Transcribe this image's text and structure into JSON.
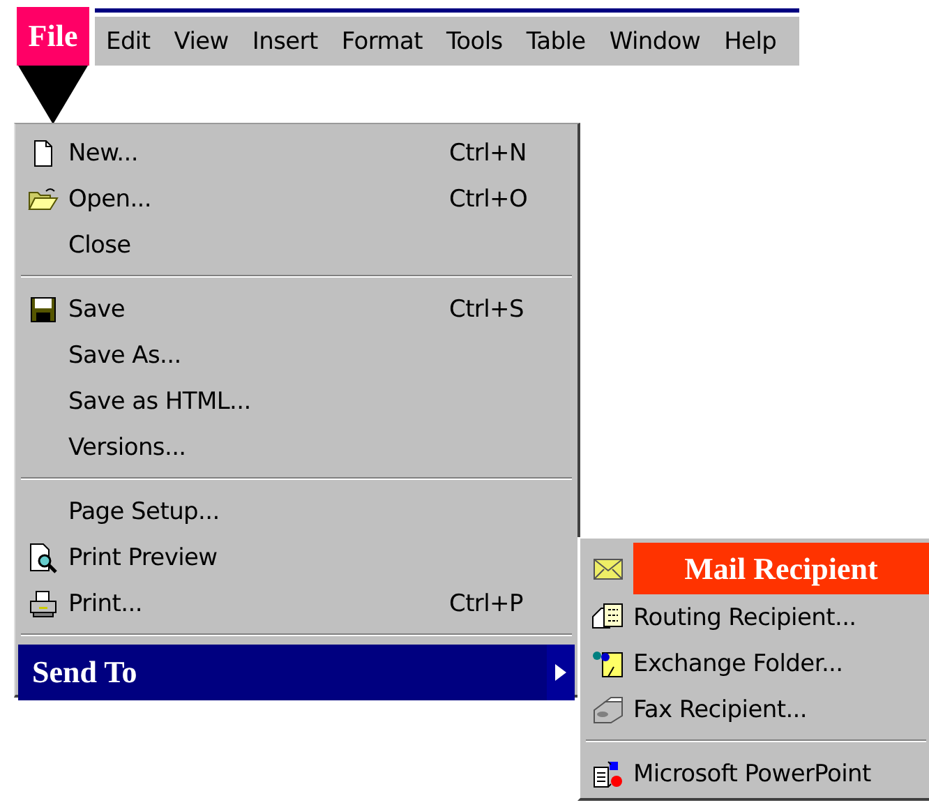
{
  "menubar": {
    "file_badge": {
      "label": "File"
    },
    "items": [
      {
        "label": "Edit"
      },
      {
        "label": "View"
      },
      {
        "label": "Insert"
      },
      {
        "label": "Format"
      },
      {
        "label": "Tools"
      },
      {
        "label": "Table"
      },
      {
        "label": "Window"
      },
      {
        "label": "Help"
      }
    ]
  },
  "file_menu": {
    "items": [
      {
        "kind": "item",
        "label": "New...",
        "shortcut": "Ctrl+N",
        "selected": false
      },
      {
        "kind": "item",
        "label": "Open...",
        "shortcut": "Ctrl+O",
        "selected": false
      },
      {
        "kind": "item",
        "label": "Close",
        "selected": false
      },
      {
        "kind": "separator"
      },
      {
        "kind": "item",
        "label": "Save",
        "shortcut": "Ctrl+S",
        "selected": false
      },
      {
        "kind": "item",
        "label": "Save As...",
        "selected": false
      },
      {
        "kind": "item",
        "label": "Save as HTML...",
        "selected": false
      },
      {
        "kind": "item",
        "label": "Versions...",
        "selected": false
      },
      {
        "kind": "separator"
      },
      {
        "kind": "item",
        "label": "Page Setup...",
        "selected": false
      },
      {
        "kind": "item",
        "label": "Print Preview",
        "selected": false
      },
      {
        "kind": "item",
        "label": "Print...",
        "shortcut": "Ctrl+P",
        "selected": false
      },
      {
        "kind": "separator"
      },
      {
        "kind": "item",
        "label": "Send To",
        "submenu": true,
        "selected": true
      }
    ]
  },
  "send_to_menu": {
    "items": [
      {
        "kind": "item",
        "label": "Mail Recipient",
        "selected": true
      },
      {
        "kind": "item",
        "label": "Routing Recipient...",
        "selected": false
      },
      {
        "kind": "item",
        "label": "Exchange Folder...",
        "selected": false
      },
      {
        "kind": "item",
        "label": "Fax Recipient...",
        "selected": false
      },
      {
        "kind": "separator"
      },
      {
        "kind": "item",
        "label": "Microsoft PowerPoint",
        "selected": false
      }
    ]
  }
}
